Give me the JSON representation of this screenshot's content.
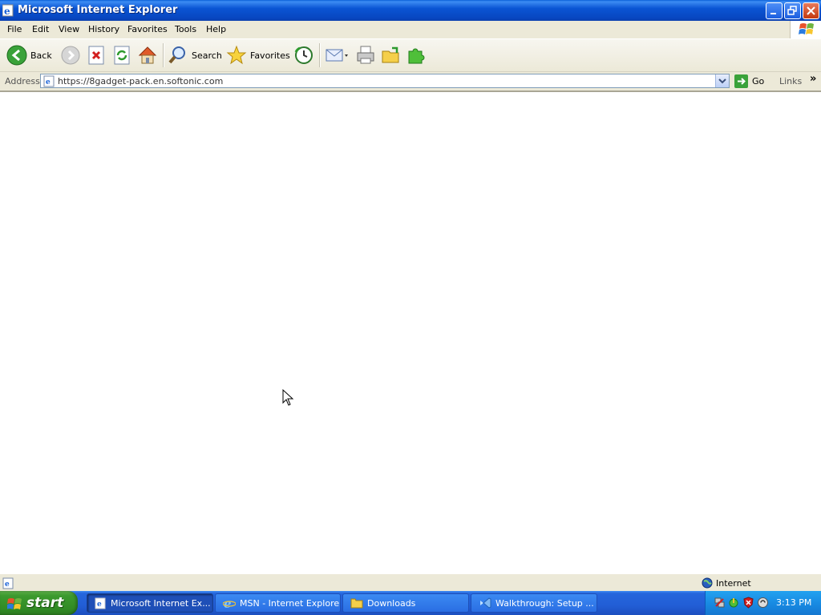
{
  "window": {
    "title": "Microsoft Internet Explorer"
  },
  "menu": {
    "items": [
      {
        "label": "File"
      },
      {
        "label": "Edit"
      },
      {
        "label": "View"
      },
      {
        "label": "History"
      },
      {
        "label": "Favorites"
      },
      {
        "label": "Tools"
      },
      {
        "label": "Help"
      }
    ]
  },
  "toolbar": {
    "back_label": "Back",
    "search_label": "Search",
    "favorites_label": "Favorites"
  },
  "address": {
    "label": "Address",
    "url": "https://8gadget-pack.en.softonic.com",
    "go_label": "Go",
    "links_label": "Links"
  },
  "status": {
    "zone_label": "Internet"
  },
  "taskbar": {
    "start_label": "start",
    "tasks": [
      {
        "label": "Microsoft Internet Ex...",
        "active": true
      },
      {
        "label": "MSN - Internet Explorer",
        "active": false
      },
      {
        "label": "Downloads",
        "active": false
      },
      {
        "label": "Walkthrough: Setup ...",
        "active": false
      }
    ],
    "clock": "3:13 PM"
  },
  "colors": {
    "titlebar": "#0a55d4",
    "chrome": "#ece9d8",
    "taskbar": "#225ed6",
    "start_button": "#318a25",
    "tray": "#1787e0"
  }
}
